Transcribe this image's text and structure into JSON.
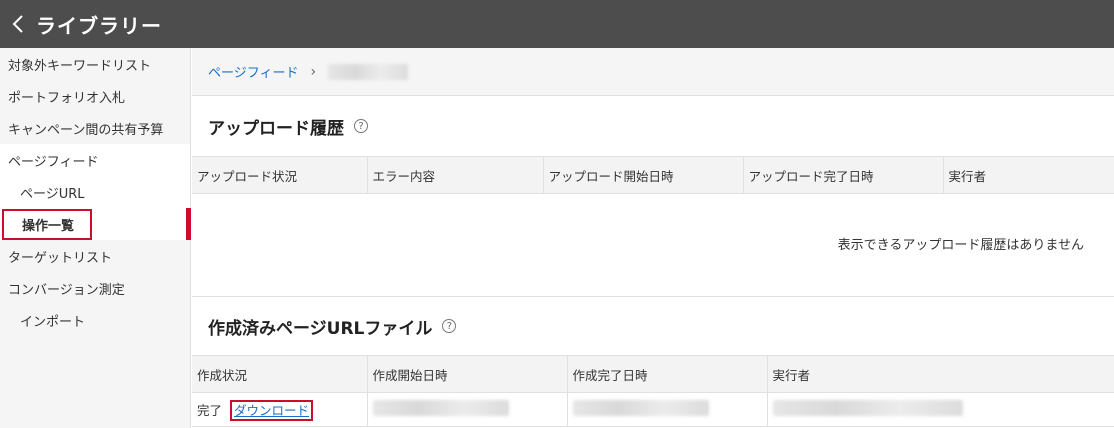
{
  "header": {
    "title": "ライブラリー",
    "back_icon": "chevron-left-icon"
  },
  "sidebar": {
    "items": [
      {
        "label": "対象外キーワードリスト"
      },
      {
        "label": "ポートフォリオ入札"
      },
      {
        "label": "キャンペーン間の共有予算"
      },
      {
        "label": "ページフィード"
      },
      {
        "label": "ページURL"
      },
      {
        "label": "操作一覧"
      },
      {
        "label": "ターゲットリスト"
      },
      {
        "label": "コンバージョン測定"
      },
      {
        "label": "インポート"
      }
    ]
  },
  "breadcrumb": {
    "parent": "ページフィード",
    "separator": "›"
  },
  "upload_history": {
    "title": "アップロード履歴",
    "help_icon": "?",
    "columns": [
      "アップロード状況",
      "エラー内容",
      "アップロード開始日時",
      "アップロード完了日時",
      "実行者"
    ],
    "empty_message": "表示できるアップロード履歴はありません"
  },
  "created_files": {
    "title": "作成済みページURLファイル",
    "help_icon": "?",
    "columns": [
      "作成状況",
      "作成開始日時",
      "作成完了日時",
      "実行者"
    ],
    "rows": [
      {
        "status": "完了",
        "download": "ダウンロード"
      }
    ]
  },
  "colors": {
    "accent_red": "#c8102e",
    "link_blue": "#1a6ec7",
    "topbar": "#4d4d4d"
  }
}
